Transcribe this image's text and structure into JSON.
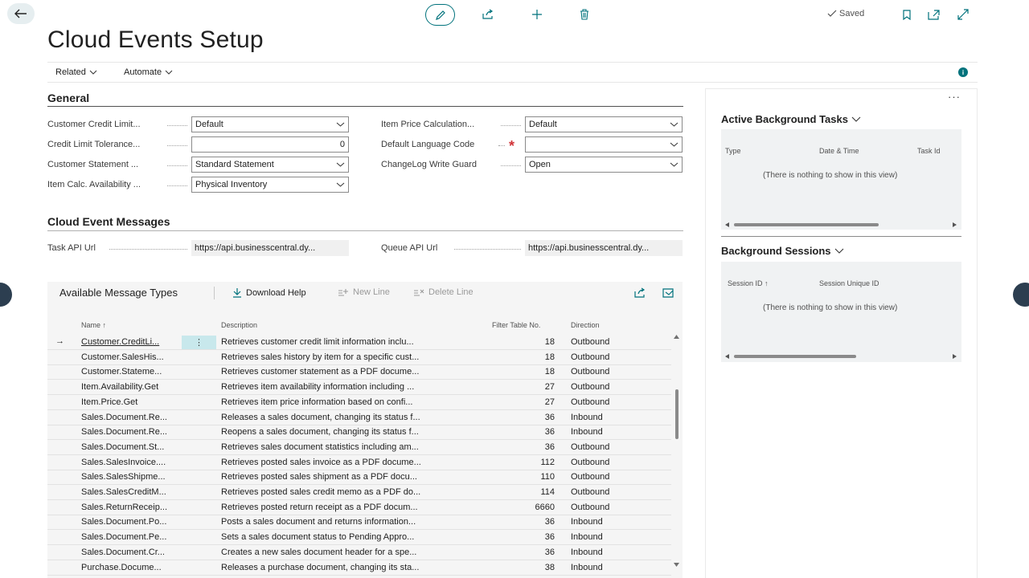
{
  "header": {
    "saved_label": "Saved",
    "title": "Cloud Events Setup"
  },
  "actions": {
    "related": "Related",
    "automate": "Automate",
    "info": "i"
  },
  "general": {
    "title": "General",
    "fields": [
      {
        "label": "Customer Credit Limit...",
        "value": "Default"
      },
      {
        "label": "Credit Limit Tolerance...",
        "value": "0"
      },
      {
        "label": "Customer Statement ...",
        "value": "Standard Statement"
      },
      {
        "label": "Item Calc. Availability ...",
        "value": "Physical Inventory"
      },
      {
        "label": "Item Price Calculation...",
        "value": "Default"
      },
      {
        "label": "Default Language Code",
        "value": ""
      },
      {
        "label": "ChangeLog Write Guard",
        "value": "Open"
      }
    ]
  },
  "messages": {
    "title": "Cloud Event Messages",
    "task_api_label": "Task API Url",
    "task_api_value": "https://api.businesscentral.dy...",
    "queue_api_label": "Queue API Url",
    "queue_api_value": "https://api.businesscentral.dy..."
  },
  "list": {
    "title": "Available Message Types",
    "download_help": "Download Help",
    "new_line": "New Line",
    "delete_line": "Delete Line",
    "columns": {
      "name": "Name ↑",
      "description": "Description",
      "filter_table": "Filter Table No.",
      "direction": "Direction"
    },
    "rows": [
      {
        "name": "Customer.CreditLi...",
        "description": "Retrieves customer credit limit information inclu...",
        "filter": "18",
        "direction": "Outbound"
      },
      {
        "name": "Customer.SalesHis...",
        "description": "Retrieves sales history by item for a specific cust...",
        "filter": "18",
        "direction": "Outbound"
      },
      {
        "name": "Customer.Stateme...",
        "description": "Retrieves customer statement as a PDF docume...",
        "filter": "18",
        "direction": "Outbound"
      },
      {
        "name": "Item.Availability.Get",
        "description": "Retrieves item availability information including ...",
        "filter": "27",
        "direction": "Outbound"
      },
      {
        "name": "Item.Price.Get",
        "description": "Retrieves item price information based on confi...",
        "filter": "27",
        "direction": "Outbound"
      },
      {
        "name": "Sales.Document.Re...",
        "description": "Releases a sales document, changing its status f...",
        "filter": "36",
        "direction": "Inbound"
      },
      {
        "name": "Sales.Document.Re...",
        "description": "Reopens a sales document, changing its status f...",
        "filter": "36",
        "direction": "Inbound"
      },
      {
        "name": "Sales.Document.St...",
        "description": "Retrieves sales document statistics including am...",
        "filter": "36",
        "direction": "Outbound"
      },
      {
        "name": "Sales.SalesInvoice....",
        "description": "Retrieves posted sales invoice as a PDF docume...",
        "filter": "112",
        "direction": "Outbound"
      },
      {
        "name": "Sales.SalesShipme...",
        "description": "Retrieves posted sales shipment as a PDF docu...",
        "filter": "110",
        "direction": "Outbound"
      },
      {
        "name": "Sales.SalesCreditM...",
        "description": "Retrieves posted sales credit memo as a PDF do...",
        "filter": "114",
        "direction": "Outbound"
      },
      {
        "name": "Sales.ReturnReceip...",
        "description": "Retrieves posted return receipt as a PDF docum...",
        "filter": "6660",
        "direction": "Outbound"
      },
      {
        "name": "Sales.Document.Po...",
        "description": "Posts a sales document and returns information...",
        "filter": "36",
        "direction": "Inbound"
      },
      {
        "name": "Sales.Document.Pe...",
        "description": "Sets a sales document status to Pending Appro...",
        "filter": "36",
        "direction": "Inbound"
      },
      {
        "name": "Sales.Document.Cr...",
        "description": "Creates a new sales document header for a spe...",
        "filter": "36",
        "direction": "Inbound"
      },
      {
        "name": "Purchase.Docume...",
        "description": "Releases a purchase document, changing its sta...",
        "filter": "38",
        "direction": "Inbound"
      }
    ]
  },
  "factbox": {
    "tasks_title": "Active Background Tasks",
    "tasks_cols": {
      "type": "Type",
      "datetime": "Date & Time",
      "taskid": "Task Id"
    },
    "tasks_empty": "(There is nothing to show in this view)",
    "sessions_title": "Background Sessions",
    "sessions_cols": {
      "id": "Session ID ↑",
      "unique": "Session Unique ID"
    },
    "sessions_empty": "(There is nothing to show in this view)"
  }
}
